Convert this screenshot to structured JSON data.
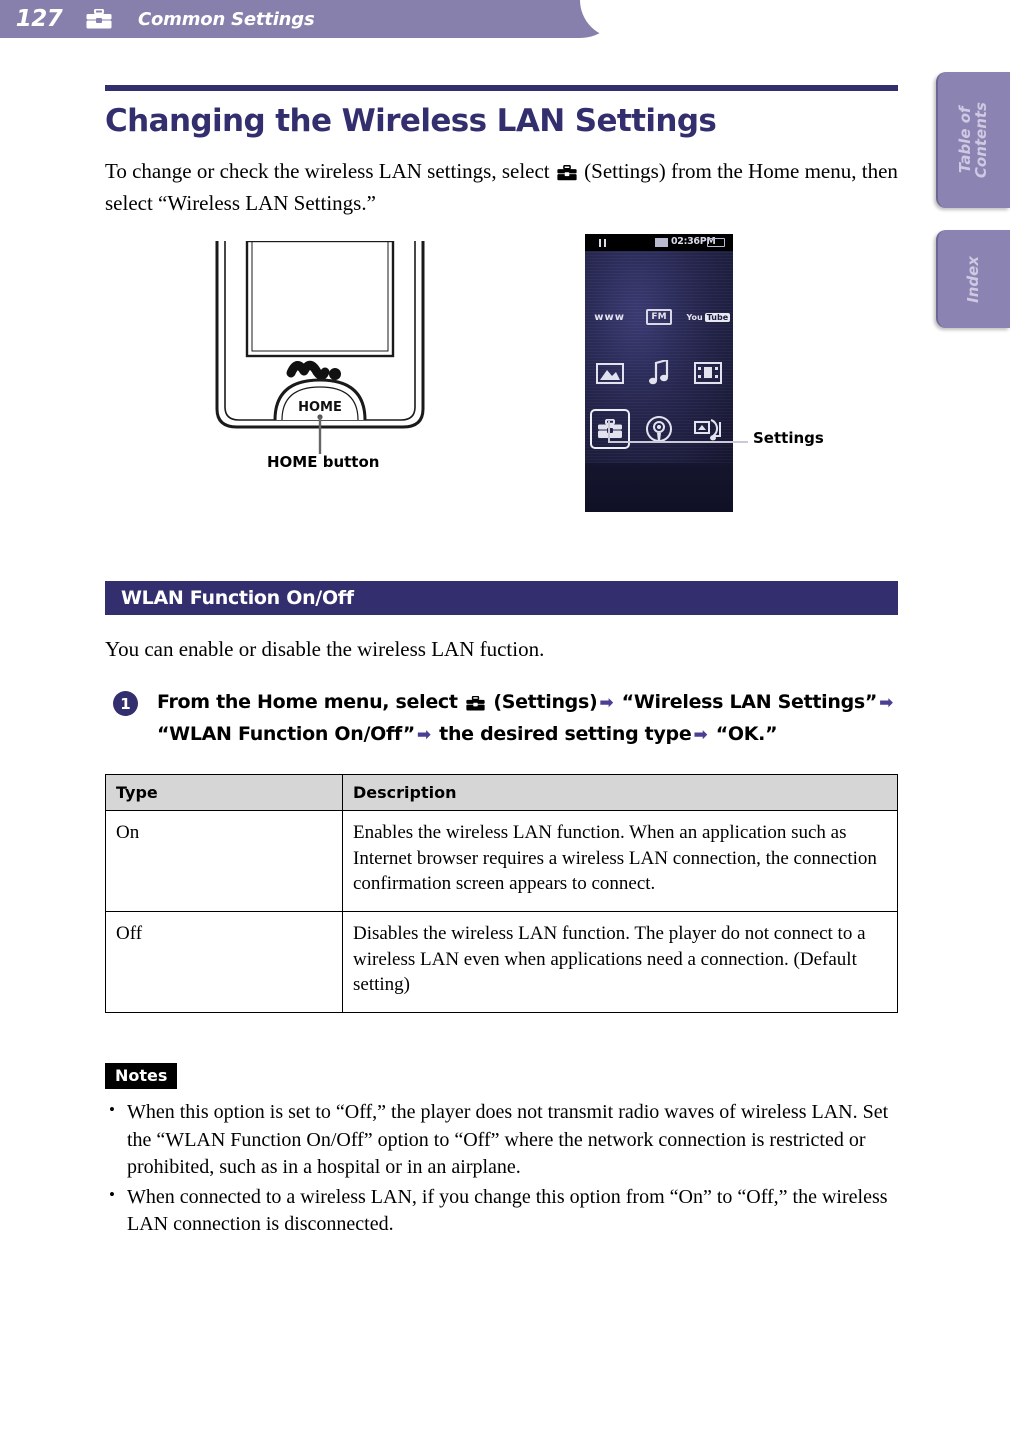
{
  "header": {
    "page_number": "127",
    "icon": "toolbox-settings-icon",
    "title": "Common Settings",
    "bar_color": "#8780ac"
  },
  "side_tabs": [
    {
      "label": "Table of\nContents",
      "name": "table-of-contents"
    },
    {
      "label": "Index",
      "name": "index"
    }
  ],
  "side_tabs_flat": {
    "toc_line1": "Table of",
    "toc_line2": "Contents",
    "index": "Index"
  },
  "main": {
    "title": "Changing the Wireless LAN Settings",
    "title_color": "#332e6e",
    "intro_part1": "To change or check the wireless LAN settings, select ",
    "intro_part2": " (Settings) from the Home menu, then select “Wireless LAN Settings.”"
  },
  "figure": {
    "home_button_caption": "HOME button",
    "walkman_logo": "WALKMAN",
    "home_label": "HOME",
    "settings_caption": "Settings",
    "screen": {
      "status_time": "02:36PM",
      "status_pause_icon": "pause-icon",
      "status_wlan_icon": "wlan-icon",
      "status_battery_icon": "battery-icon",
      "icons": [
        {
          "name": "internet-browser-icon",
          "label": "www"
        },
        {
          "name": "fm-radio-icon",
          "label": "FM"
        },
        {
          "name": "youtube-icon",
          "label_you": "You",
          "label_tube": "Tube"
        },
        {
          "name": "photo-icon",
          "label": ""
        },
        {
          "name": "music-icon",
          "label": "♪"
        },
        {
          "name": "video-icon",
          "label": ""
        },
        {
          "name": "settings-icon",
          "label": "",
          "selected": true
        },
        {
          "name": "podcast-icon",
          "label": ""
        },
        {
          "name": "music-transfer-icon",
          "label": ""
        }
      ]
    }
  },
  "section": {
    "heading": "WLAN Function On/Off",
    "heading_bg": "#332e6e",
    "intro": "You can enable or disable the wireless LAN fuction."
  },
  "step": {
    "number": "1",
    "text_a": "From the Home menu, select ",
    "text_b": " (Settings)",
    "arrow": "➡",
    "text_c": " “Wireless LAN Settings”",
    "text_d": " “WLAN Function On/Off”",
    "text_e": " the desired setting type",
    "text_f": " “OK.”"
  },
  "table": {
    "columns": [
      "Type",
      "Description"
    ],
    "rows": [
      {
        "type": "On",
        "description": "Enables the wireless LAN function. When an application such as Internet browser requires a wireless LAN connection, the connection confirmation screen appears to connect."
      },
      {
        "type": "Off",
        "description": "Disables the wireless LAN function. The player do not connect to a wireless LAN even when applications need a connection. (Default setting)"
      }
    ]
  },
  "notes": {
    "badge": "Notes",
    "items": [
      "When this option is set to “Off,” the player does not transmit radio waves of wireless LAN. Set the “WLAN Function On/Off” option to “Off” where the network connection is restricted or prohibited, such as in a hospital or in an airplane.",
      "When connected to a wireless LAN, if you change this option from “On” to “Off,” the wireless LAN connection is disconnected."
    ]
  }
}
